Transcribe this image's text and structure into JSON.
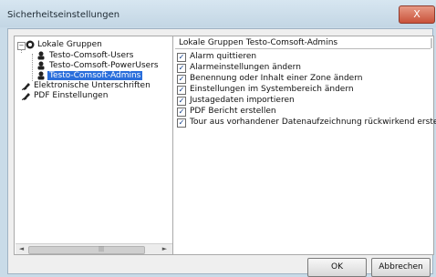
{
  "window": {
    "title": "Sicherheitseinstellungen",
    "close_label": "X"
  },
  "tree": {
    "items": [
      {
        "label": "Lokale Gruppen",
        "expander": "−"
      },
      {
        "label": "Testo-Comsoft-Users"
      },
      {
        "label": "Testo-Comsoft-PowerUsers"
      },
      {
        "label": "Testo-Comsoft-Admins"
      },
      {
        "label": "Elektronische Unterschriften"
      },
      {
        "label": "PDF Einstellungen"
      }
    ],
    "scroll_left": "◄",
    "scroll_right": "►",
    "scroll_grip": "|||"
  },
  "panel": {
    "title": "Lokale Gruppen Testo-Comsoft-Admins",
    "permissions": [
      {
        "label": "Alarm quittieren",
        "checked": true
      },
      {
        "label": "Alarmeinstellungen ändern",
        "checked": true
      },
      {
        "label": "Benennung oder Inhalt einer Zone ändern",
        "checked": true
      },
      {
        "label": "Einstellungen im Systembereich ändern",
        "checked": true
      },
      {
        "label": "Justagedaten importieren",
        "checked": true
      },
      {
        "label": "PDF Bericht erstellen",
        "checked": true
      },
      {
        "label": "Tour aus vorhandener Datenaufzeichnung rückwirkend erstellen",
        "checked": true
      }
    ],
    "check_mark": "✓"
  },
  "buttons": {
    "ok": "OK",
    "cancel": "Abbrechen"
  },
  "colors": {
    "selection": "#2a6edb",
    "titlebar": "#c9dbe8",
    "close": "#c9523a"
  }
}
